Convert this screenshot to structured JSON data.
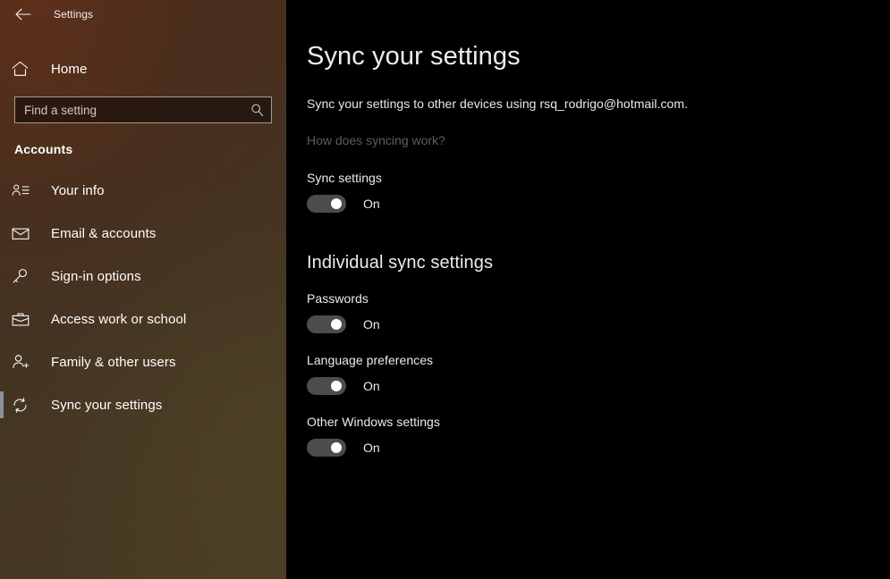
{
  "window": {
    "title": "Settings",
    "back_icon": "back-arrow-icon"
  },
  "sidebar": {
    "home": {
      "label": "Home",
      "icon": "home-icon"
    },
    "search": {
      "placeholder": "Find a setting",
      "value": "",
      "icon": "search-icon"
    },
    "category": "Accounts",
    "items": [
      {
        "label": "Your info",
        "icon": "contact-card-icon",
        "selected": false
      },
      {
        "label": "Email & accounts",
        "icon": "envelope-icon",
        "selected": false
      },
      {
        "label": "Sign-in options",
        "icon": "key-icon",
        "selected": false
      },
      {
        "label": "Access work or school",
        "icon": "briefcase-icon",
        "selected": false
      },
      {
        "label": "Family & other users",
        "icon": "person-add-icon",
        "selected": false
      },
      {
        "label": "Sync your settings",
        "icon": "sync-icon",
        "selected": true
      }
    ]
  },
  "main": {
    "title": "Sync your settings",
    "description": "Sync your settings to other devices using rsq_rodrigo@hotmail.com.",
    "help_link": "How does syncing work?",
    "sync_settings": {
      "label": "Sync settings",
      "state": "On",
      "on": true
    },
    "section_heading": "Individual sync settings",
    "individual": [
      {
        "label": "Passwords",
        "state": "On",
        "on": true
      },
      {
        "label": "Language preferences",
        "state": "On",
        "on": true
      },
      {
        "label": "Other Windows settings",
        "state": "On",
        "on": true
      }
    ]
  },
  "colors": {
    "sidebar_top": "#4b2c1d",
    "sidebar_bottom": "#473a24",
    "content_bg": "#000000",
    "toggle_track": "#4c4c4c",
    "toggle_knob": "#ffffff",
    "selection_bar": "#8d9199",
    "muted_text": "#5e5e5e"
  }
}
